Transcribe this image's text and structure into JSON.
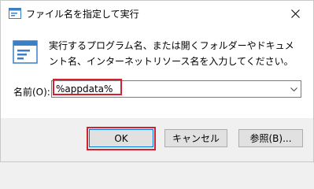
{
  "window": {
    "title": "ファイル名を指定して実行"
  },
  "dialog": {
    "description": "実行するプログラム名、または開くフォルダーやドキュメント名、インターネットリソース名を入力してください。",
    "name_label": "名前(O):",
    "name_value": "%appdata%"
  },
  "buttons": {
    "ok": "OK",
    "cancel": "キャンセル",
    "browse": "参照(B)..."
  },
  "icons": {
    "app": "run-icon",
    "big": "run-icon",
    "close": "close-icon",
    "dropdown": "chevron-down-icon"
  },
  "colors": {
    "highlight": "#d3212d",
    "primary_border": "#0078d7"
  }
}
